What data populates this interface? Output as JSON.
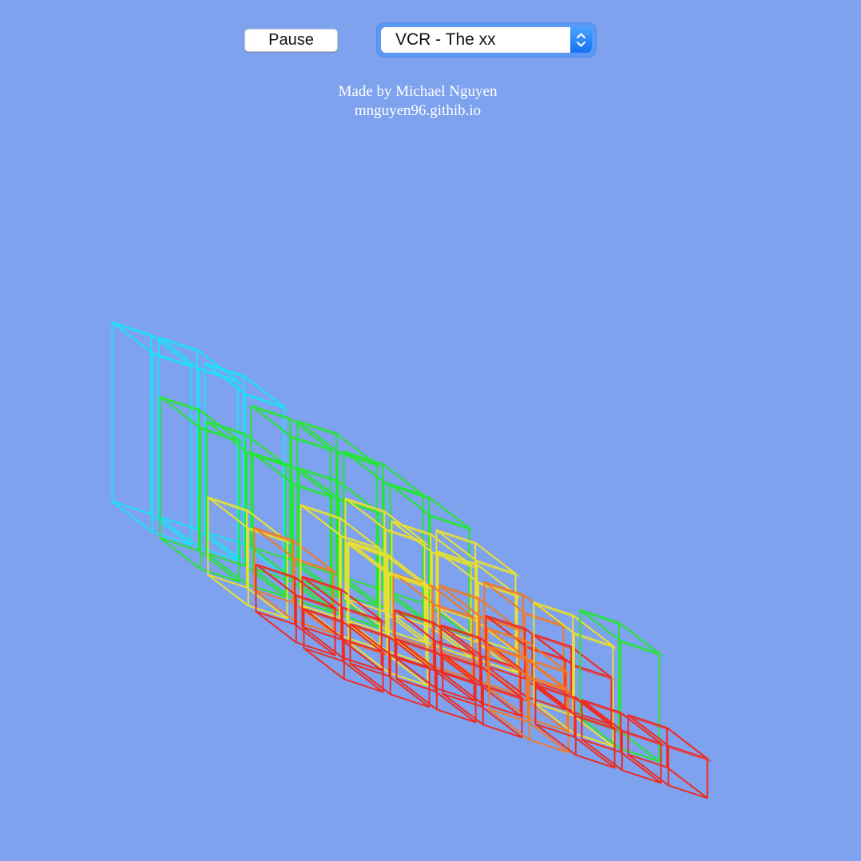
{
  "controls": {
    "pause_label": "Pause",
    "track_selected": "VCR - The xx"
  },
  "credits": {
    "made_by": "Made by Michael Nguyen",
    "site": "mnguyen96.githib.io"
  },
  "visualizer": {
    "style": "wireframe 3D bar grid",
    "rows": 5,
    "cols": 8,
    "level_scale": [
      0,
      1
    ],
    "levels": [
      [
        0.97,
        0.97,
        0.9,
        0.72,
        0.72,
        0.62,
        0.5,
        0.3
      ],
      [
        0.72,
        0.66,
        0.55,
        0.55,
        0.45,
        0.4,
        0.3,
        0.2
      ],
      [
        0.3,
        0.2,
        0.45,
        0.3,
        0.2,
        0.22,
        0.12,
        0.1
      ],
      [
        0.1,
        0.12,
        0.45,
        0.1,
        0.1,
        0.18,
        0.45,
        0.5
      ],
      [
        0.05,
        0.05,
        0.05,
        0.05,
        0.2,
        0.05,
        0.05,
        0.05
      ]
    ],
    "colors": {
      "background": "#7fa2ef",
      "cyan": "#18e4f5",
      "blue": "#2cb0f5",
      "green": "#22e830",
      "yellow": "#e8e030",
      "orange": "#f07a2a",
      "red": "#f02a20"
    }
  }
}
